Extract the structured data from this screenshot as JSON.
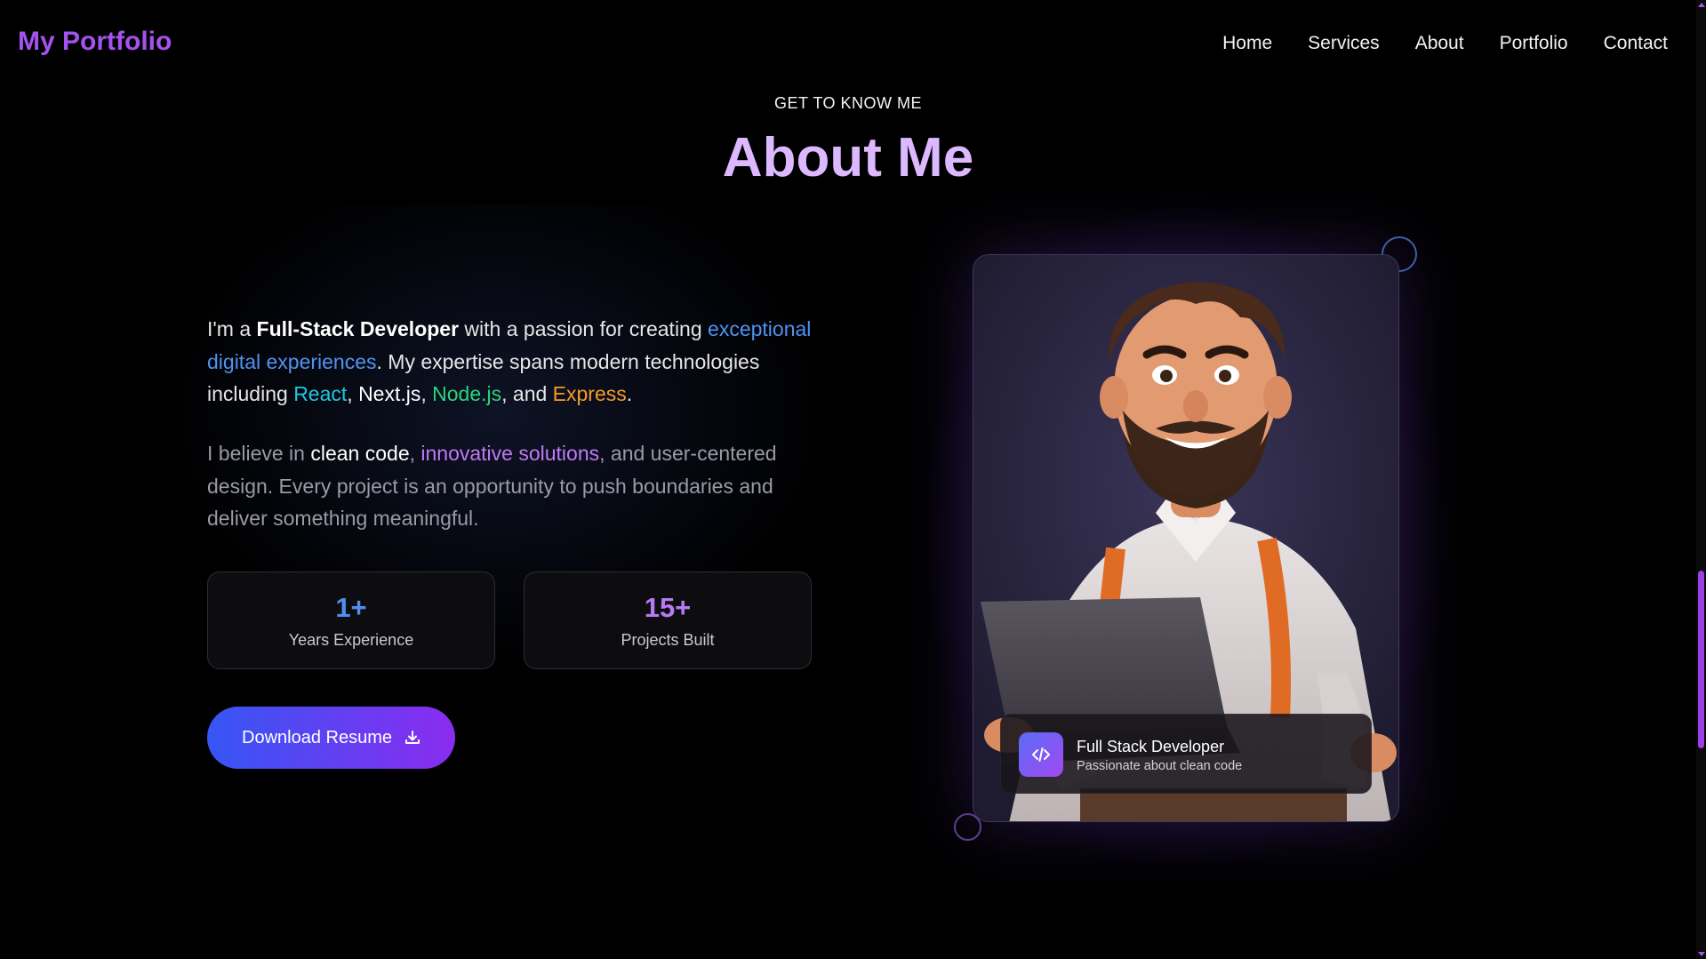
{
  "nav": {
    "logo": "My Portfolio",
    "links": [
      "Home",
      "Services",
      "About",
      "Portfolio",
      "Contact"
    ]
  },
  "about": {
    "eyebrow": "GET TO KNOW ME",
    "title": "About Me",
    "paragraph1": {
      "t1": "I'm a ",
      "role": "Full-Stack Developer",
      "t2": " with a passion for creating ",
      "highlight": "exceptional digital experiences",
      "t3": ". My expertise spans modern technologies including ",
      "tech1": "React",
      "sep1": ", ",
      "tech2": "Next.js",
      "sep2": ", ",
      "tech3": "Node.js",
      "sep3": ", and ",
      "tech4": "Express",
      "t4": "."
    },
    "paragraph2": {
      "t1": "I believe in ",
      "h1": "clean code",
      "sep1": ", ",
      "h2": "innovative solutions",
      "t2": ", and user-centered design. Every project is an opportunity to push boundaries and deliver something meaningful."
    },
    "stats": [
      {
        "value": "1+",
        "label": "Years Experience"
      },
      {
        "value": "15+",
        "label": "Projects Built"
      }
    ],
    "download_button": "Download Resume",
    "card": {
      "role_title": "Full Stack Developer",
      "role_subtitle": "Passionate about clean code"
    }
  },
  "colors": {
    "accent_purple": "#a552f0",
    "heading_lavender": "#dcb8ff",
    "button_gradient_start": "#3656f4",
    "button_gradient_end": "#8a2cf0"
  },
  "icons": {
    "download": "download-icon",
    "code": "code-icon"
  }
}
